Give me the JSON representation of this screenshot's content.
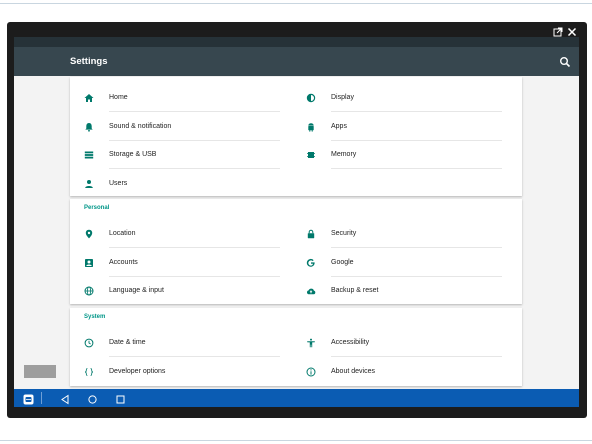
{
  "window": {
    "controls": {
      "popout_icon": "popout-icon",
      "close_icon": "close-icon"
    }
  },
  "appbar": {
    "title": "Settings",
    "search_icon": "search-icon"
  },
  "colors": {
    "accent": "#009688",
    "appbar": "#37474f",
    "statusbar": "#263238",
    "navbar": "#0b5cb3",
    "icon": "#00796b"
  },
  "sections": [
    {
      "header": "",
      "items": [
        {
          "label": "Home",
          "icon": "home-icon"
        },
        {
          "label": "Display",
          "icon": "brightness-icon"
        },
        {
          "label": "Sound & notification",
          "icon": "bell-icon"
        },
        {
          "label": "Apps",
          "icon": "android-icon"
        },
        {
          "label": "Storage & USB",
          "icon": "storage-icon"
        },
        {
          "label": "Memory",
          "icon": "memory-icon"
        },
        {
          "label": "Users",
          "icon": "person-icon"
        }
      ]
    },
    {
      "header": "Personal",
      "items": [
        {
          "label": "Location",
          "icon": "location-pin-icon"
        },
        {
          "label": "Security",
          "icon": "lock-icon"
        },
        {
          "label": "Accounts",
          "icon": "account-box-icon"
        },
        {
          "label": "Google",
          "icon": "google-icon"
        },
        {
          "label": "Language & input",
          "icon": "globe-icon"
        },
        {
          "label": "Backup & reset",
          "icon": "cloud-upload-icon"
        }
      ]
    },
    {
      "header": "System",
      "items": [
        {
          "label": "Date & time",
          "icon": "clock-icon"
        },
        {
          "label": "Accessibility",
          "icon": "accessibility-icon"
        },
        {
          "label": "Developer options",
          "icon": "code-braces-icon"
        },
        {
          "label": "About devices",
          "icon": "info-icon"
        }
      ]
    }
  ],
  "navbar": {
    "buttons": [
      "app-icon",
      "back-icon",
      "home-circle-icon",
      "recents-icon"
    ]
  }
}
